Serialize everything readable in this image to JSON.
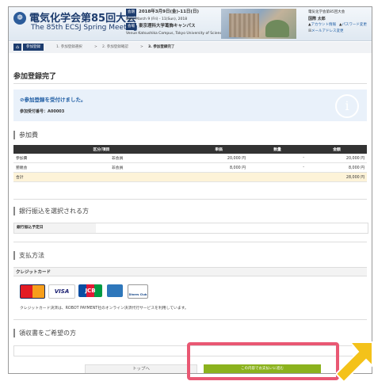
{
  "header": {
    "logo_glyph": "❁",
    "title_jp": "電気化学会第85回大会",
    "title_en": "The 85th ECSJ Spring Meeting",
    "period_tag": "会期",
    "period_jp": "2018年3月9日(金)-11日(日)",
    "period_en": "Date March 9 (Fri) - 11(Sun), 2018",
    "venue_tag": "会場",
    "venue_jp": "東京理科大学葛飾キャンパス",
    "venue_en": "Venue Katsushika Campus, Tokyo University of Science"
  },
  "user": {
    "event": "電気化学会第85回大会",
    "name": "国際 太郎",
    "link_account": "アカウント情報",
    "link_password": "パスワード変更",
    "link_email": "メールアドレス変更"
  },
  "breadcrumb": {
    "home_glyph": "⌂",
    "step0": "参加登録",
    "step1": "1. 参加登録選択",
    "sep1": ">",
    "step2": "2. 参加登録確認",
    "sep2": ">",
    "step3": "3. 参加登録完了"
  },
  "page_title": "参加登録完了",
  "notice": {
    "message": "⊘参加登録を受付けました。",
    "number_label": "参加受付番号：A00003",
    "icon_glyph": "i"
  },
  "fees": {
    "section_title": "参加費",
    "columns": [
      "区分/項目",
      "単価",
      "数量",
      "金額"
    ],
    "rows": [
      {
        "item": "参加費",
        "category": "非会員",
        "unit_price": "20,000 円",
        "qty": "-",
        "amount": "20,000 円"
      },
      {
        "item": "懇親会",
        "category": "非会員",
        "unit_price": "8,000 円",
        "qty": "-",
        "amount": "8,000 円"
      }
    ],
    "total_label": "合計",
    "total_amount": "28,000 円"
  },
  "bank": {
    "section_title": "銀行振込を選択される方",
    "date_label": "銀行振込予定日"
  },
  "payment": {
    "section_title": "支払方法",
    "method_label": "クレジットカード",
    "cards": [
      "MasterCard",
      "VISA",
      "JCB",
      "AMEX",
      "Diners Club"
    ],
    "note": "クレジットカード決済は、ROBOT PAYMENT社のオンライン決済代行サービスを利用しています。"
  },
  "receipt": {
    "section_title": "領収書をご希望の方"
  },
  "buttons": {
    "top": "トップへ",
    "next": "この内容でお支払いに進む"
  },
  "colors": {
    "brand_navy": "#1d3c6e",
    "next_button": "#8bb21d",
    "highlight": "#e95873",
    "arrow": "#f4c21a"
  }
}
